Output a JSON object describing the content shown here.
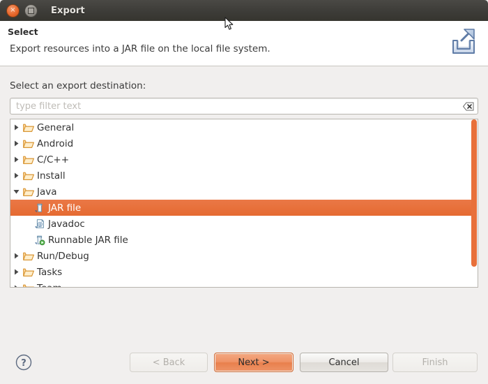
{
  "window": {
    "title": "Export",
    "close_label": "×",
    "maximize_label": ""
  },
  "header": {
    "title": "Select",
    "description": "Export resources into a JAR file on the local file system.",
    "icon": "export-wizard-icon"
  },
  "main": {
    "destination_label": "Select an export destination:",
    "filter": {
      "placeholder": "type filter text",
      "value": "",
      "clear_icon": "clear-field-icon"
    },
    "tree": [
      {
        "label": "General",
        "icon": "folder-icon",
        "expanded": false,
        "level": 0,
        "selected": false
      },
      {
        "label": "Android",
        "icon": "folder-icon",
        "expanded": false,
        "level": 0,
        "selected": false
      },
      {
        "label": "C/C++",
        "icon": "folder-icon",
        "expanded": false,
        "level": 0,
        "selected": false
      },
      {
        "label": "Install",
        "icon": "folder-icon",
        "expanded": false,
        "level": 0,
        "selected": false
      },
      {
        "label": "Java",
        "icon": "folder-icon",
        "expanded": true,
        "level": 0,
        "selected": false
      },
      {
        "label": "JAR file",
        "icon": "jar-file-icon",
        "expanded": null,
        "level": 1,
        "selected": true
      },
      {
        "label": "Javadoc",
        "icon": "javadoc-icon",
        "expanded": null,
        "level": 1,
        "selected": false
      },
      {
        "label": "Runnable JAR file",
        "icon": "runnable-jar-icon",
        "expanded": null,
        "level": 1,
        "selected": false
      },
      {
        "label": "Run/Debug",
        "icon": "folder-icon",
        "expanded": false,
        "level": 0,
        "selected": false
      },
      {
        "label": "Tasks",
        "icon": "folder-icon",
        "expanded": false,
        "level": 0,
        "selected": false
      },
      {
        "label": "Team",
        "icon": "folder-icon",
        "expanded": false,
        "level": 0,
        "selected": false
      }
    ]
  },
  "footer": {
    "help_icon": "help-question-icon",
    "buttons": {
      "back": {
        "label": "< Back",
        "enabled": false,
        "default": false
      },
      "next": {
        "label": "Next >",
        "enabled": true,
        "default": true
      },
      "cancel": {
        "label": "Cancel",
        "enabled": true,
        "default": false
      },
      "finish": {
        "label": "Finish",
        "enabled": false,
        "default": false
      }
    }
  },
  "colors": {
    "titlebar": "#3d3c38",
    "selection_orange": "#e8703a",
    "default_button_orange": "#ee9468",
    "scrollbar_orange": "#e8703a",
    "panel_background": "#f1efee",
    "field_background": "#ffffff"
  }
}
